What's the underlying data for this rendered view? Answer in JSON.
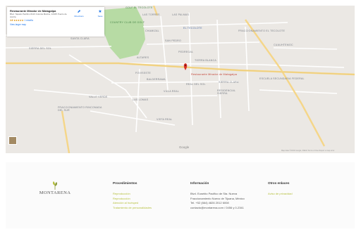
{
  "map": {
    "info_card": {
      "title": "Restaurante Mirador de Matagalpa",
      "address": "Blvd. Tapatio Pacifico #123 Colonia Marina, 12345 Puerto de Acuña",
      "rating": "4.6 ★★★★★",
      "reviews": "1 reseña",
      "view_larger": "View larger map",
      "directions_label": "Directions",
      "save_label": "Save"
    },
    "labels": {
      "golf": "Golf El Tecolote",
      "las_torres": "LAS TORRES",
      "las_palmas": "LAS PALMAS",
      "country_club": "Country Club de Golf",
      "chamizal": "CHAMIZAL",
      "san_pedro": "SAN PEDRO",
      "el_tecolote": "El Tecolote",
      "fraccionamiento": "FRACCIONAMIENTO EL TECOLOTE",
      "santa_clara": "SANTA CLARA",
      "sierra_del_sol": "SIERRA DEL SOL",
      "altares": "ALTARES",
      "pedregal": "PEDREGAL",
      "tierra_blanca": "TIERRA BLANCA",
      "fovissste": "FOVISSSTE",
      "balderrama": "BALDERRAMA",
      "restaurant_pin": "Restaurante Mirador de Matagalpa",
      "villa_real": "VILLA REAL",
      "real_del_sol": "REAL DEL SOL",
      "sierra_clara": "SIERRA CLARA",
      "residencial": "RESIDENCIAL SIERRA",
      "escuela": "ESCUELA SECUNDARIA FEDERAL",
      "fracc_sur": "FRACCIONAMIENTO RINCONADA DEL SUR",
      "las_lomas": "LAS LOMAS",
      "valle_verde": "VALLE VERDE",
      "vista_real": "VISTA REAL",
      "cuauhtemoc": "CUAUHTEMOC"
    },
    "google": "Google",
    "footer_text": "Map data ©2019 Google, INEGI   Terms of Use   Report a map error"
  },
  "footer": {
    "logo_text": "MONTARENA",
    "columns": [
      {
        "title": "Procedimientos",
        "links": [
          "Reproducción",
          "Reproducción",
          "Atención al huésped",
          "Tratamiento de personalidades"
        ]
      },
      {
        "title": "Información",
        "lines": [
          "Blvd. Eusebio Pacifico de Sta. Nueva",
          "Fraccionamiento Nuevo de Tijuana, México",
          "Tel. +52 (664) 4826 2012 6008",
          "contacto@montarena.com / 0456 y 0-2341"
        ]
      },
      {
        "title": "Otros enlaces",
        "links": [
          "Aviso de privacidad"
        ]
      }
    ]
  },
  "colors": {
    "map_bg": "#ebe8e4",
    "park": "#b7dba4",
    "road_major": "#f5d689",
    "road_minor": "#ffffff",
    "pin": "#d93025",
    "link_green": "#b5bf3c"
  }
}
